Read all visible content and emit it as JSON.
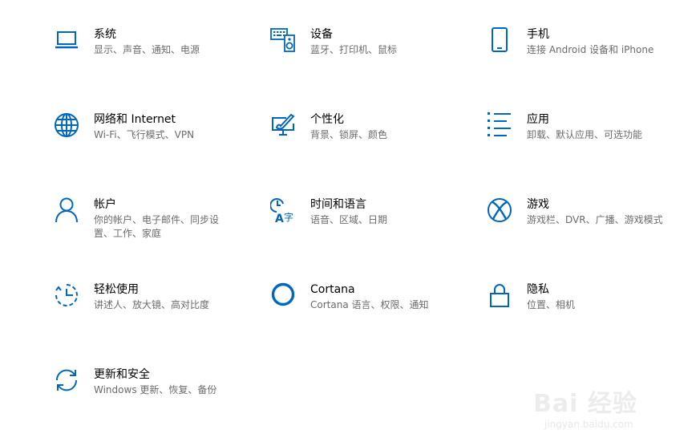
{
  "accent": "#0067c0",
  "tiles": [
    {
      "title": "系统",
      "desc": "显示、声音、通知、电源",
      "icon": "laptop-icon"
    },
    {
      "title": "设备",
      "desc": "蓝牙、打印机、鼠标",
      "icon": "keyboard-speaker-icon"
    },
    {
      "title": "手机",
      "desc": "连接 Android 设备和 iPhone",
      "icon": "phone-icon"
    },
    {
      "title": "网络和 Internet",
      "desc": "Wi-Fi、飞行模式、VPN",
      "icon": "globe-icon"
    },
    {
      "title": "个性化",
      "desc": "背景、锁屏、颜色",
      "icon": "paintbrush-monitor-icon"
    },
    {
      "title": "应用",
      "desc": "卸载、默认应用、可选功能",
      "icon": "app-list-icon"
    },
    {
      "title": "帐户",
      "desc": "你的帐户、电子邮件、同步设置、工作、家庭",
      "icon": "person-icon"
    },
    {
      "title": "时间和语言",
      "desc": "语音、区域、日期",
      "icon": "clock-language-icon"
    },
    {
      "title": "游戏",
      "desc": "游戏栏、DVR、广播、游戏模式",
      "icon": "xbox-icon"
    },
    {
      "title": "轻松使用",
      "desc": "讲述人、放大镜、高对比度",
      "icon": "ease-of-access-icon"
    },
    {
      "title": "Cortana",
      "desc": "Cortana 语言、权限、通知",
      "icon": "cortana-icon"
    },
    {
      "title": "隐私",
      "desc": "位置、相机",
      "icon": "lock-icon"
    },
    {
      "title": "更新和安全",
      "desc": "Windows 更新、恢复、备份",
      "icon": "sync-icon"
    }
  ],
  "watermark": {
    "main": "Bai 经验",
    "sub": "jingyan.baidu.com"
  }
}
